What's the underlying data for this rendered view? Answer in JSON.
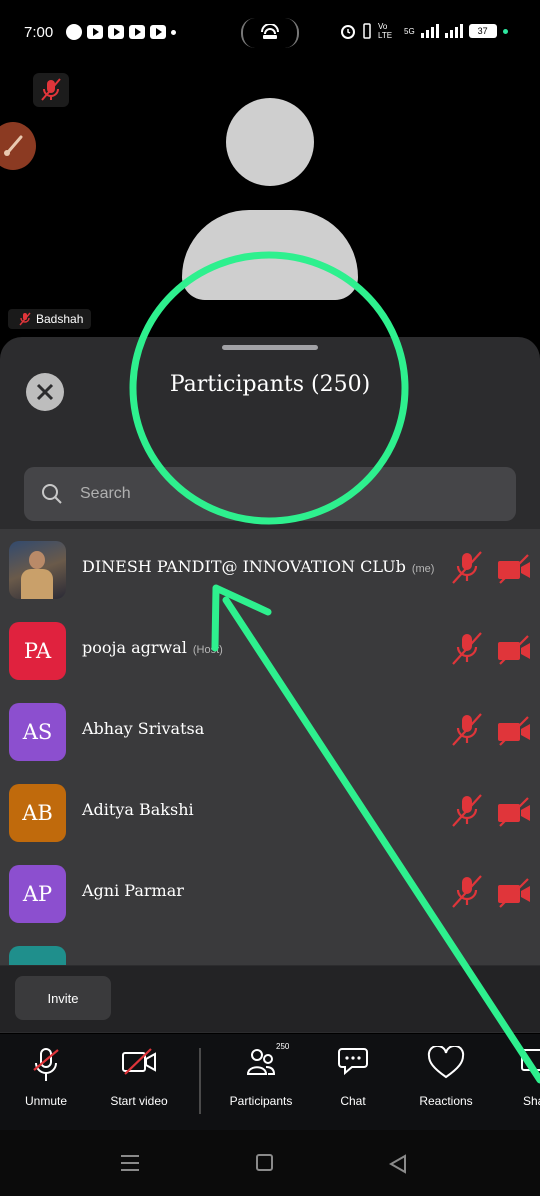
{
  "status_bar": {
    "time": "7:00",
    "network_label": "Vo LTE",
    "network_type": "5G",
    "battery": "37"
  },
  "video": {
    "speaker_name": "Badshah",
    "icons": [
      "mic-off-icon",
      "brush-icon",
      "person-silhouette-icon"
    ]
  },
  "participants_sheet": {
    "title": "Participants (250)",
    "search_placeholder": "Search",
    "participants": [
      {
        "initials": "",
        "name": "DINESH PANDIT@ INNOVATION CLUb",
        "tag": "(me)",
        "avatar_color": "photo"
      },
      {
        "initials": "PA",
        "name": "pooja agrwal",
        "tag": "(Host)",
        "avatar_color": "#e0223e"
      },
      {
        "initials": "AS",
        "name": "Abhay Srivatsa",
        "tag": "",
        "avatar_color": "#8c4fcf"
      },
      {
        "initials": "AB",
        "name": "Aditya Bakshi",
        "tag": "",
        "avatar_color": "#c06a0c"
      },
      {
        "initials": "AP",
        "name": "Agni Parmar",
        "tag": "",
        "avatar_color": "#8c4fcf"
      }
    ],
    "partial_avatar_color": "#1f8f8c",
    "invite_label": "Invite",
    "muted_color": "#e0353a"
  },
  "toolbar": {
    "unmute": "Unmute",
    "start_video": "Start video",
    "participants": "Participants",
    "participants_count": "250",
    "chat": "Chat",
    "reactions": "Reactions",
    "share": "Sha"
  },
  "annotation_color": "#2ef08e"
}
